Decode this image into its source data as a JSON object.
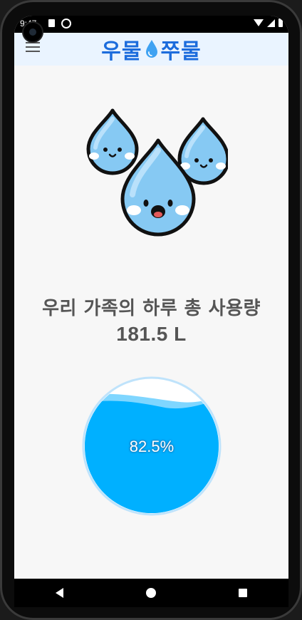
{
  "status_bar": {
    "time": "9:47"
  },
  "app": {
    "logo_text_left": "우물",
    "logo_text_right": "쭈물"
  },
  "main": {
    "headline": "우리 가족의 하루 총 사용량",
    "total_usage": "181.5 L",
    "gauge": {
      "percent_label": "82.5%",
      "fill_fraction": 0.825
    }
  },
  "icons": [
    "menu-icon",
    "water-drop-logo-icon",
    "water-drop-characters-illustration",
    "back-icon",
    "home-icon",
    "recents-icon"
  ],
  "colors": {
    "accent": "#1c6cdc",
    "water": "#00b0ff",
    "water_light": "#7fd6ff",
    "appbar_bg": "#eaf4ff"
  }
}
